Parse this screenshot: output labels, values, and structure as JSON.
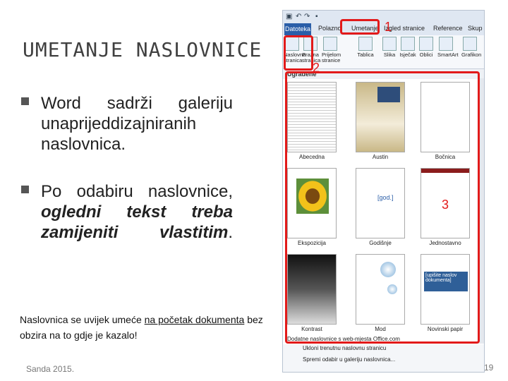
{
  "slide": {
    "title": "UMETANJE NASLOVNICE",
    "bullet1": "Word sadrži galeriju unaprijeddizajniranih naslovnica.",
    "bullet2_lead": "Po odabiru naslovnice,",
    "bullet2_bold": "ogledni tekst treba zamijeniti vlastitim",
    "bullet2_end": ".",
    "note_pre": "Naslovnica se uvijek umeće",
    "note_link": "na početak dokumenta",
    "note_post": "bez obzira na to gdje je kazalo!",
    "footer_left": "Sanda 2015.",
    "page_number": "19"
  },
  "word": {
    "tabs": [
      "Datoteka",
      "Polazno",
      "Umetanje",
      "Izgled stranice",
      "Reference",
      "Skup"
    ],
    "ribbon_buttons": [
      "Naslovna stranica",
      "Prazna stranica",
      "Prijelom stranice",
      "Tablica",
      "Slika",
      "Isječak",
      "Oblici",
      "SmartArt",
      "Grafikon"
    ],
    "gallery_header": "Ugrađene",
    "thumbnails": [
      "Abecedna",
      "Austin",
      "Bočnica",
      "Ekspozicija",
      "Godišnje",
      "Jednostavno",
      "Kontrast",
      "Mod",
      "Novinski papir"
    ],
    "menu": [
      "Dodatne naslovnice s web-mjesta Office.com",
      "Ukloni trenutnu naslovnu stranicu",
      "Spremi odabir u galeriju naslovnica..."
    ],
    "thumb_text": {
      "god": "[god.]",
      "naslov": "[upišite naslov dokumenta]",
      "mali_naslov": "[upišite naslov dokumenta]"
    }
  },
  "annotations": [
    "1",
    "2",
    "3"
  ],
  "colors": {
    "highlight": "#e21a1a",
    "file_tab": "#2a5ea8",
    "bullet": "#555555"
  }
}
